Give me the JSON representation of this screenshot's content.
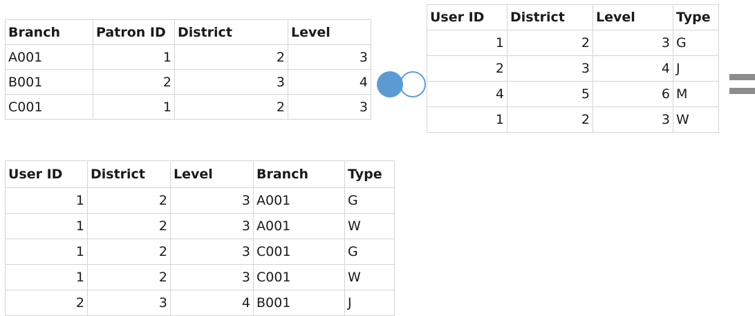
{
  "left_table": {
    "headers": [
      "Branch",
      "Patron ID",
      "District",
      "Level"
    ],
    "rows": [
      [
        "A001",
        "1",
        "2",
        "3"
      ],
      [
        "B001",
        "2",
        "3",
        "4"
      ],
      [
        "C001",
        "1",
        "2",
        "3"
      ]
    ]
  },
  "right_table": {
    "headers": [
      "User ID",
      "District",
      "Level",
      "Type"
    ],
    "rows": [
      [
        "1",
        "2",
        "3",
        "G"
      ],
      [
        "2",
        "3",
        "4",
        "J"
      ],
      [
        "4",
        "5",
        "6",
        "M"
      ],
      [
        "1",
        "2",
        "3",
        "W"
      ]
    ]
  },
  "result_table": {
    "headers": [
      "User ID",
      "District",
      "Level",
      "Branch",
      "Type"
    ],
    "rows": [
      [
        "1",
        "2",
        "3",
        "A001",
        "G"
      ],
      [
        "1",
        "2",
        "3",
        "A001",
        "W"
      ],
      [
        "1",
        "2",
        "3",
        "C001",
        "G"
      ],
      [
        "1",
        "2",
        "3",
        "C001",
        "W"
      ],
      [
        "2",
        "3",
        "4",
        "B001",
        "J"
      ]
    ]
  },
  "join_icon": {
    "name": "left-join-icon",
    "fill_color": "#5b9bd5",
    "outline_color": "#5b9bd5"
  },
  "equals_icon": {
    "name": "equals-icon",
    "color": "#8c8c8c"
  }
}
